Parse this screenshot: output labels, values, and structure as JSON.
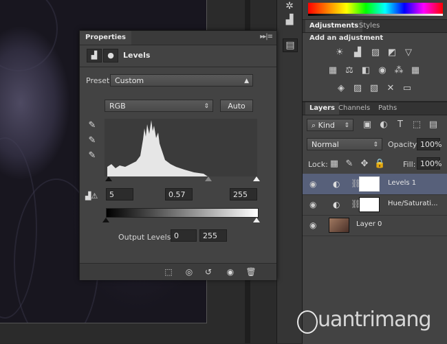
{
  "properties": {
    "tab_label": "Properties",
    "panel_menu": "▸▸|≡",
    "title": "Levels",
    "preset_label": "Preset:",
    "preset_value": "Custom",
    "channel_value": "RGB",
    "auto_label": "Auto",
    "input_black": "5",
    "input_gamma": "0.57",
    "input_white": "255",
    "output_label": "Output Levels:",
    "output_black": "0",
    "output_white": "255"
  },
  "adjustments": {
    "tabs": [
      "Adjustments",
      "Styles"
    ],
    "heading": "Add an adjustment"
  },
  "layers": {
    "tabs": [
      "Layers",
      "Channels",
      "Paths"
    ],
    "kind_label": "Kind",
    "blend_mode": "Normal",
    "opacity_label": "Opacity:",
    "opacity_value": "100%",
    "lock_label": "Lock:",
    "fill_label": "Fill:",
    "fill_value": "100%",
    "items": [
      {
        "name": "Levels 1"
      },
      {
        "name": "Hue/Saturati..."
      },
      {
        "name": "Layer 0"
      }
    ]
  },
  "watermark": {
    "text": "uantrimang"
  },
  "colors": {
    "selected_layer": "#57607a",
    "panel": "#434343"
  }
}
